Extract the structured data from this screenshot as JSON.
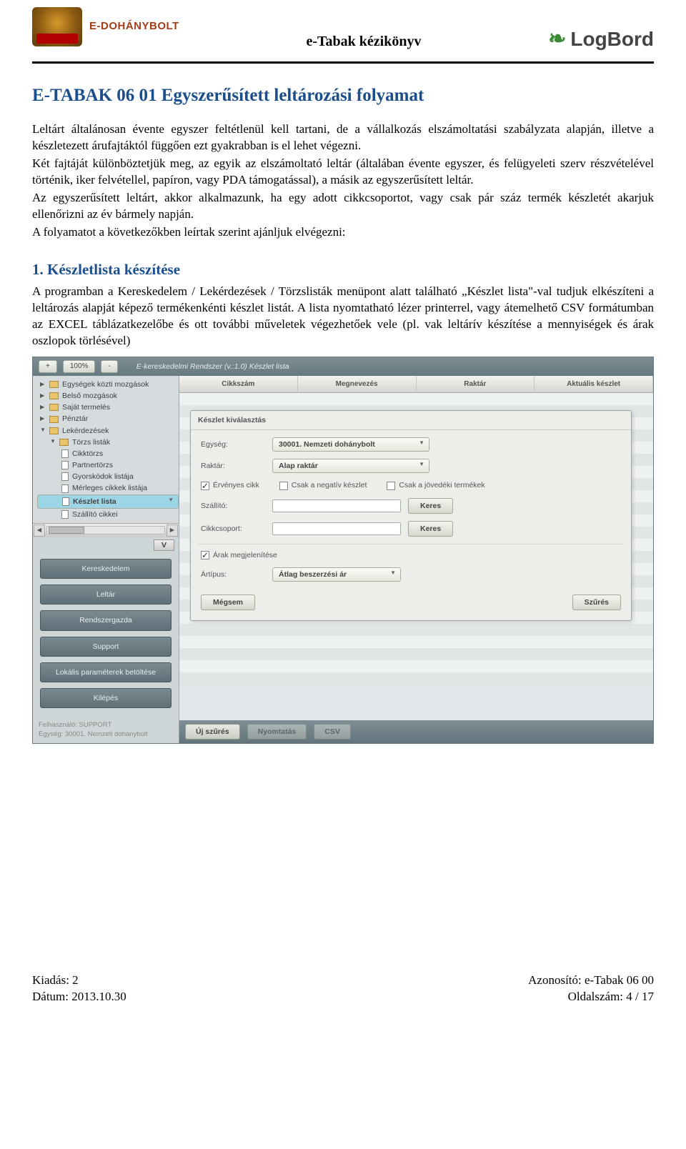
{
  "header": {
    "brand_text": "E-DOHÁNYBOLT",
    "center_title": "e-Tabak kézikönyv",
    "logbord_text": "LogBord"
  },
  "doc": {
    "title": "E-TABAK 06 01  Egyszerűsített leltározási folyamat",
    "para1": "Leltárt általánosan évente egyszer feltétlenül kell tartani, de a vállalkozás elszámoltatási szabályzata alapján, illetve a készletezett árufajtáktól függően ezt gyakrabban is el lehet végezni.",
    "para2": "Két fajtáját különböztetjük meg, az egyik az elszámoltató leltár (általában évente egyszer, és felügyeleti szerv részvételével történik, iker felvétellel, papíron, vagy PDA támogatással), a másik az egyszerűsített leltár.",
    "para3": "Az egyszerűsített leltárt, akkor alkalmazunk, ha egy adott cikkcsoportot, vagy csak pár száz termék készletét akarjuk ellenőrizni az év bármely napján.",
    "para4": "A folyamatot a következőkben leírtak szerint ajánljuk elvégezni:",
    "sec1_title": "1.  Készletlista készítése",
    "sec1_body": "A programban a Kereskedelem / Lekérdezések / Törzslisták menüpont alatt található „Készlet lista\"-val tudjuk elkészíteni a leltározás alapját képező termékenkénti készlet listát. A lista nyomtatható lézer printerrel, vagy átemelhető CSV formátumban az EXCEL táblázatkezelőbe és ott további műveletek végezhetőek vele (pl. vak leltárív készítése a mennyiségek és árak oszlopok törlésével)"
  },
  "app": {
    "toolbar": {
      "plus": "+",
      "zoom": "100%",
      "minus": "-",
      "title": "E-kereskedelmi Rendszer (v.:1.0)   Készlet lista"
    },
    "tree": {
      "n1": "Egységek közti mozgások",
      "n2": "Belső mozgások",
      "n3": "Saját termelés",
      "n4": "Pénztár",
      "n5": "Lekérdezések",
      "n5a": "Törzs listák",
      "n5a1": "Cikktörzs",
      "n5a2": "Partnertörzs",
      "n5a3": "Gyorskódok listája",
      "n5a4": "Mérleges cikkek listája",
      "n5a5": "Készlet lista",
      "n5a6": "Szállító cikkei"
    },
    "nav": {
      "b1": "Kereskedelem",
      "b2": "Leltár",
      "b3": "Rendszergazda",
      "b4": "Support",
      "b5": "Lokális paraméterek betöltése",
      "b6": "Kilépés"
    },
    "user": {
      "l1": "Felhasználó:  SUPPORT",
      "l2": "Egység:    30001. Nemzeti dohánybolt"
    },
    "cols": {
      "c1": "Cikkszám",
      "c2": "Megnevezés",
      "c3": "Raktár",
      "c4": "Aktuális készlet"
    },
    "dialog": {
      "title": "Készlet kiválasztás",
      "unit_label": "Egység:",
      "unit_value": "30001. Nemzeti dohánybolt",
      "store_label": "Raktár:",
      "store_value": "Alap raktár",
      "chk_valid": "Érvényes cikk",
      "chk_neg": "Csak a negatív készlet",
      "chk_excise": "Csak a jövedéki termékek",
      "supplier_label": "Szállító:",
      "group_label": "Cikkcsoport:",
      "search_btn": "Keres",
      "chk_price": "Árak megjelenítése",
      "pricetype_label": "Ártípus:",
      "pricetype_value": "Átlag beszerzési ár",
      "cancel": "Mégsem",
      "filter": "Szűrés"
    },
    "bottom": {
      "b1": "Új szűrés",
      "b2": "Nyomtatás",
      "b3": "CSV"
    }
  },
  "footer": {
    "l1": "Kiadás: 2",
    "l2": "Dátum: 2013.10.30",
    "r1": "Azonosító: e-Tabak 06 00",
    "r2": "Oldalszám: 4 / 17"
  }
}
